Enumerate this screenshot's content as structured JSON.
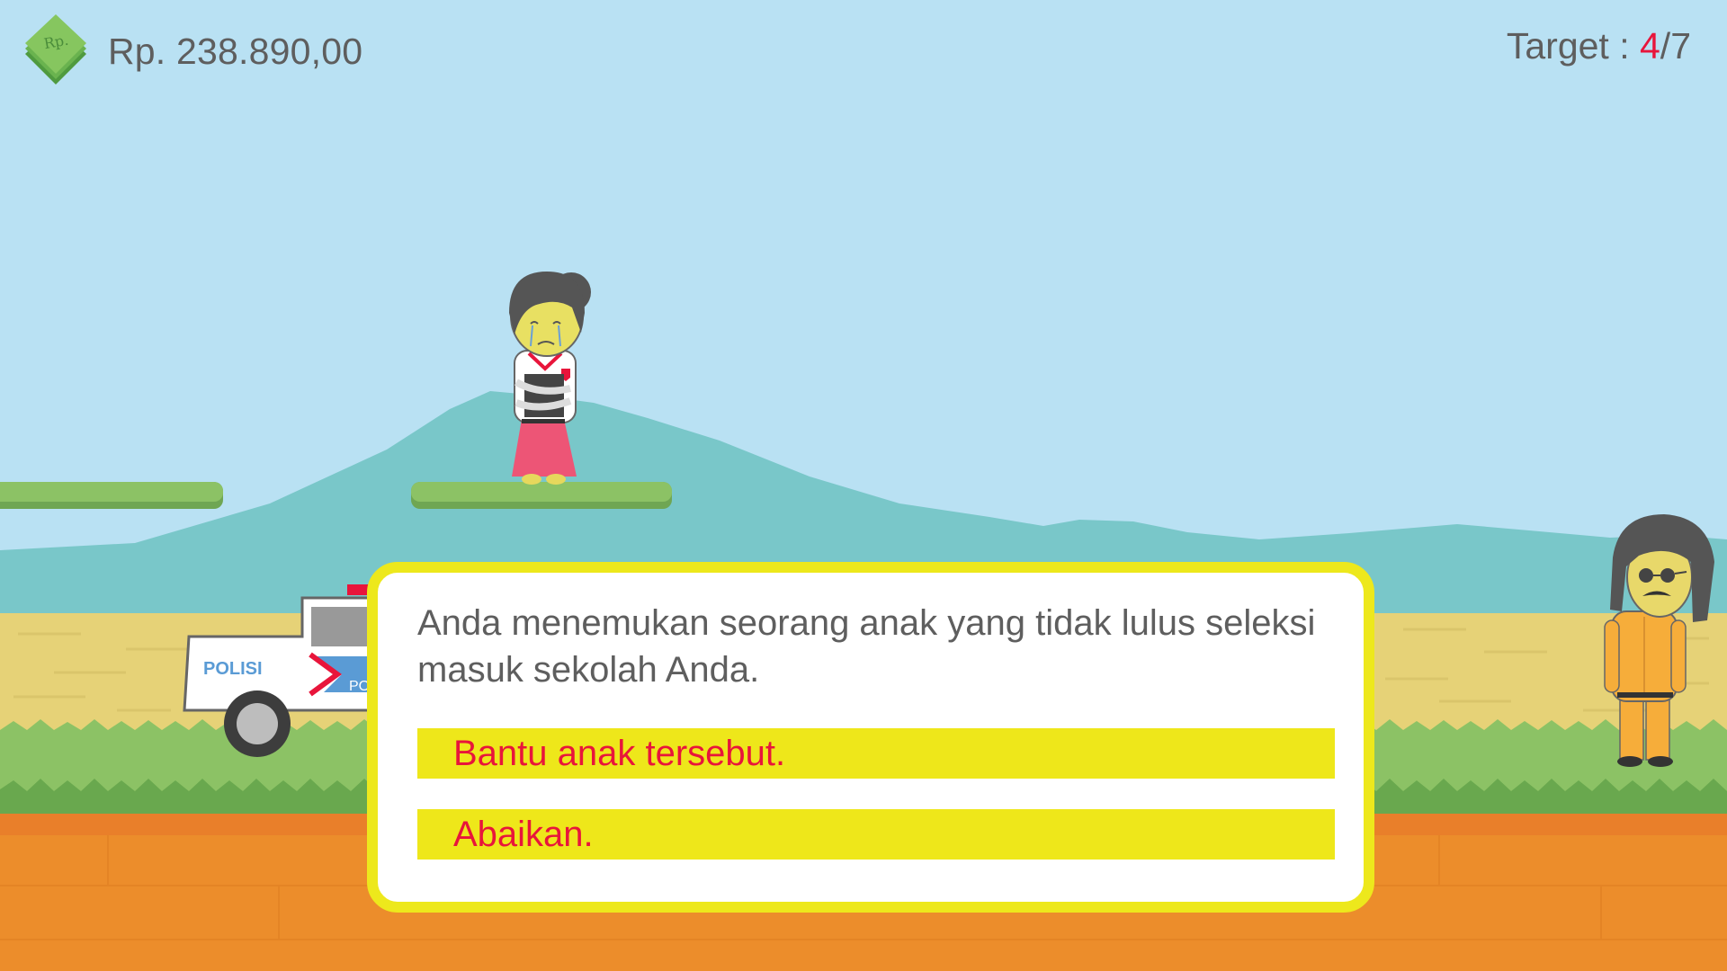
{
  "hud": {
    "money_icon_label": "Rp.",
    "money": "Rp. 238.890,00",
    "target_label": "Target : ",
    "target_current": "4",
    "target_total": "/7"
  },
  "scene": {
    "police_car_text": "POLISI",
    "police_car_text_partial": "PO"
  },
  "dialog": {
    "message": "Anda menemukan seorang anak yang tidak lulus seleksi masuk sekolah Anda.",
    "choices": [
      {
        "label": "Bantu anak tersebut."
      },
      {
        "label": "Abaikan."
      }
    ]
  },
  "colors": {
    "sky": "#b9e1f3",
    "mountain": "#79c7c9",
    "field": "#e6d277",
    "grass": "#8cc265",
    "dirt": "#ec8d2b",
    "dialog_border": "#ede81c",
    "choice_bg": "#eee71a",
    "choice_text": "#e8153b",
    "hud_text": "#5e5e5e",
    "accent_red": "#e8153b"
  }
}
